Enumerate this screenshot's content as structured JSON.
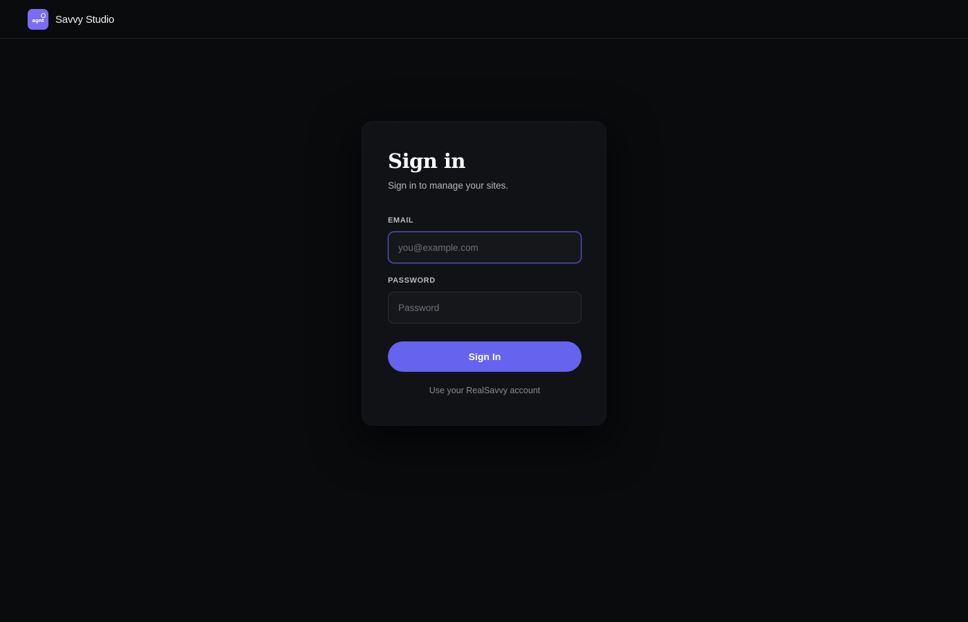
{
  "header": {
    "logo_text": "agnt",
    "brand_name": "Savvy Studio"
  },
  "signin": {
    "title": "Sign in",
    "subtitle": "Sign in to manage your sites.",
    "email_label": "EMAIL",
    "email_placeholder": "you@example.com",
    "email_value": "",
    "password_label": "PASSWORD",
    "password_placeholder": "Password",
    "password_value": "",
    "button_label": "Sign In",
    "helper_text": "Use your RealSavvy account"
  },
  "colors": {
    "background": "#0a0b0d",
    "card": "#111215",
    "accent": "#6663ee",
    "logo": "#7a6cf4",
    "focus_border": "#5b57e0"
  },
  "icons": {
    "logo": "agnt-logo-icon"
  }
}
